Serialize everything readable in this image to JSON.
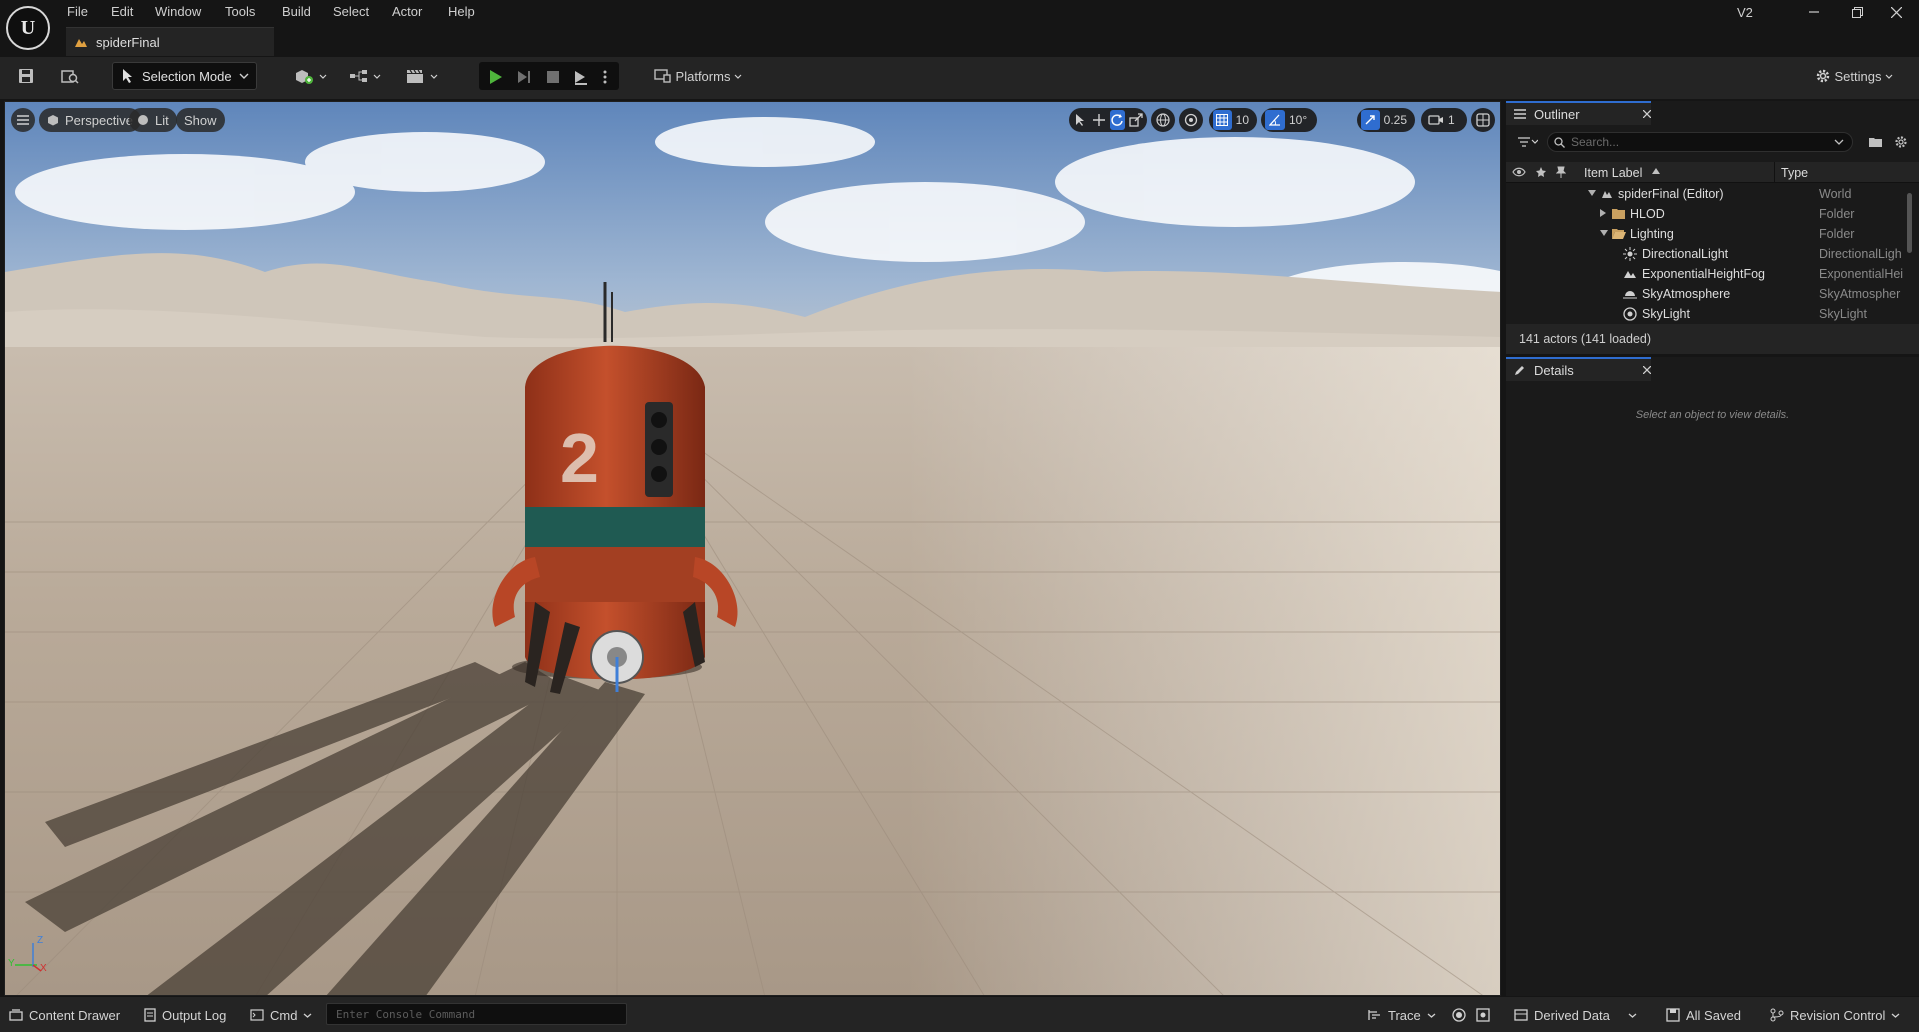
{
  "menu": [
    "File",
    "Edit",
    "Window",
    "Tools",
    "Build",
    "Select",
    "Actor",
    "Help"
  ],
  "document_tab": "spiderFinal",
  "version_label": "V2",
  "toolbar": {
    "selection_mode": "Selection Mode",
    "platforms": "Platforms",
    "settings": "Settings"
  },
  "viewport": {
    "perspective": "Perspective",
    "lit": "Lit",
    "show": "Show",
    "grid_snap": "10",
    "rotation_snap": "10°",
    "scale_snap": "0.25",
    "camera_speed": "1",
    "axis": {
      "z": "Z",
      "x": "X",
      "y": "Y"
    }
  },
  "outliner": {
    "tab": "Outliner",
    "search_placeholder": "Search...",
    "col_label": "Item Label",
    "col_type": "Type",
    "rows": [
      {
        "label": "spiderFinal (Editor)",
        "type": "World",
        "icon": "world-icon",
        "expanded": true
      },
      {
        "label": "HLOD",
        "type": "Folder",
        "icon": "folder-icon",
        "expanded": false
      },
      {
        "label": "Lighting",
        "type": "Folder",
        "icon": "folder-open-icon",
        "expanded": true
      },
      {
        "label": "DirectionalLight",
        "type": "DirectionalLigh",
        "icon": "directional-light-icon"
      },
      {
        "label": "ExponentialHeightFog",
        "type": "ExponentialHei",
        "icon": "fog-icon"
      },
      {
        "label": "SkyAtmosphere",
        "type": "SkyAtmospher",
        "icon": "sky-atmosphere-icon"
      },
      {
        "label": "SkyLight",
        "type": "SkyLight",
        "icon": "skylight-icon"
      }
    ],
    "footer": "141 actors (141 loaded)"
  },
  "details": {
    "tab": "Details",
    "empty_message": "Select an object to view details."
  },
  "statusbar": {
    "content_drawer": "Content Drawer",
    "output_log": "Output Log",
    "cmd": "Cmd",
    "console_placeholder": "Enter Console Command",
    "trace": "Trace",
    "derived_data": "Derived Data",
    "all_saved": "All Saved",
    "revision_control": "Revision Control"
  },
  "colors": {
    "accent": "#2f6dd0",
    "play": "#4fb53c",
    "robot": "#c24a2a"
  }
}
